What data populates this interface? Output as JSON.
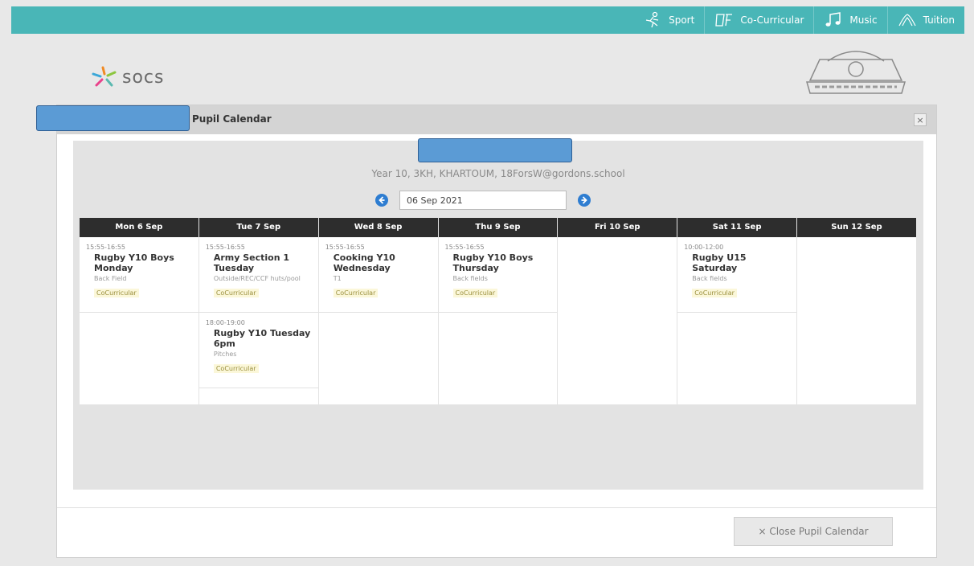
{
  "topnav": [
    {
      "label": "Sport",
      "icon": "sport-icon"
    },
    {
      "label": "Co-Curricular",
      "icon": "co-curricular-icon"
    },
    {
      "label": "Music",
      "icon": "music-note-icon"
    },
    {
      "label": "Tuition",
      "icon": "tuition-icon"
    }
  ],
  "logo": {
    "text": "socs"
  },
  "modal": {
    "title": "Pupil Calendar",
    "close_glyph": "×",
    "subtitle": "Year 10, 3KH, KHARTOUM, 18ForsW@gordons.school",
    "date_value": "06 Sep 2021",
    "close_button": "× Close Pupil Calendar"
  },
  "calendar": {
    "days": [
      {
        "header": "Mon 6 Sep",
        "events": [
          {
            "time": "15:55-16:55",
            "title": "Rugby Y10 Boys Monday",
            "location": "Back Field",
            "tag": "CoCurricular"
          }
        ]
      },
      {
        "header": "Tue 7 Sep",
        "events": [
          {
            "time": "15:55-16:55",
            "title": "Army Section 1 Tuesday",
            "location": "Outside/REC/CCF huts/pool",
            "tag": "CoCurricular"
          },
          {
            "time": "18:00-19:00",
            "title": "Rugby Y10 Tuesday 6pm",
            "location": "Pitches",
            "tag": "CoCurricular"
          }
        ]
      },
      {
        "header": "Wed 8 Sep",
        "events": [
          {
            "time": "15:55-16:55",
            "title": "Cooking Y10 Wednesday",
            "location": "T1",
            "tag": "CoCurricular"
          }
        ]
      },
      {
        "header": "Thu 9 Sep",
        "events": [
          {
            "time": "15:55-16:55",
            "title": "Rugby Y10 Boys Thursday",
            "location": "Back fields",
            "tag": "CoCurricular"
          }
        ]
      },
      {
        "header": "Fri 10 Sep",
        "events": []
      },
      {
        "header": "Sat 11 Sep",
        "events": [
          {
            "time": "10:00-12:00",
            "title": "Rugby U15 Saturday",
            "location": "Back fields",
            "tag": "CoCurricular"
          }
        ]
      },
      {
        "header": "Sun 12 Sep",
        "events": []
      }
    ]
  },
  "colors": {
    "topbar": "#49b6b7",
    "header_dark": "#2d2d2d",
    "nav_arrow": "#2e7dd1",
    "redaction": "#5b9bd5"
  }
}
